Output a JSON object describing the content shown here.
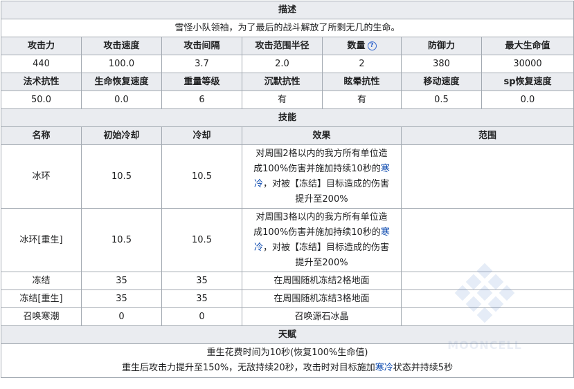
{
  "description": {
    "header": "描述",
    "text": "雪怪小队领袖，为了最后的战斗解放了所剩无几的生命。"
  },
  "stats": {
    "row1_headers": [
      "攻击力",
      "攻击速度",
      "攻击间隔",
      "攻击范围半径",
      "数量",
      "防御力",
      "最大生命值"
    ],
    "row1_values": [
      "440",
      "100.0",
      "3.7",
      "2.0",
      "2",
      "380",
      "30000"
    ],
    "row2_headers": [
      "法术抗性",
      "生命恢复速度",
      "重量等级",
      "沉默抗性",
      "眩晕抗性",
      "移动速度",
      "sp恢复速度"
    ],
    "row2_values": [
      "50.0",
      "0.0",
      "6",
      "有",
      "有",
      "0.5",
      "0.0"
    ],
    "count_help_icon": "question-circle-icon"
  },
  "skills": {
    "header": "技能",
    "columns": [
      "名称",
      "初始冷却",
      "冷却",
      "效果",
      "范围"
    ],
    "rows": [
      {
        "name": "冰环",
        "initial_cd": "10.5",
        "cd": "10.5",
        "effect_l1": "对周围2格以内的我方所有单位造",
        "effect_l2": "成100%伤害并施加持续10秒的",
        "effect_kw1": "寒",
        "effect_kw2": "冷",
        "effect_l3": "，对被【冻结】目标造成的伤害",
        "effect_l4": "提升至200%",
        "range": ""
      },
      {
        "name": "冰环[重生]",
        "initial_cd": "10.5",
        "cd": "10.5",
        "effect_l1": "对周围3格以内的我方所有单位造",
        "effect_l2": "成100%伤害并施加持续10秒的",
        "effect_kw1": "寒",
        "effect_kw2": "冷",
        "effect_l3": "，对被【冻结】目标造成的伤害",
        "effect_l4": "提升至200%",
        "range": ""
      },
      {
        "name": "冻结",
        "initial_cd": "35",
        "cd": "35",
        "effect": "在周围随机冻结2格地面",
        "range": ""
      },
      {
        "name": "冻结[重生]",
        "initial_cd": "35",
        "cd": "35",
        "effect": "在周围随机冻结3格地面",
        "range": ""
      },
      {
        "name": "召唤寒潮",
        "initial_cd": "0",
        "cd": "0",
        "effect": "召唤源石冰晶",
        "range": ""
      }
    ]
  },
  "talent": {
    "header": "天赋",
    "line1": "重生花费时间为10秒(恢复100%生命值)",
    "line2_pre": "重生后攻击力提升至150%，无敌持续20秒，攻击时对目标施加",
    "line2_kw": "寒冷",
    "line2_post": "状态并持续5秒"
  },
  "watermark": {
    "text": "MOONCELL",
    "icon": "mooncell-logo-icon"
  },
  "colors": {
    "header_bg": "#eaecf0",
    "border": "#a2a9b1",
    "link": "#0645ad",
    "help_icon": "#3366cc"
  }
}
